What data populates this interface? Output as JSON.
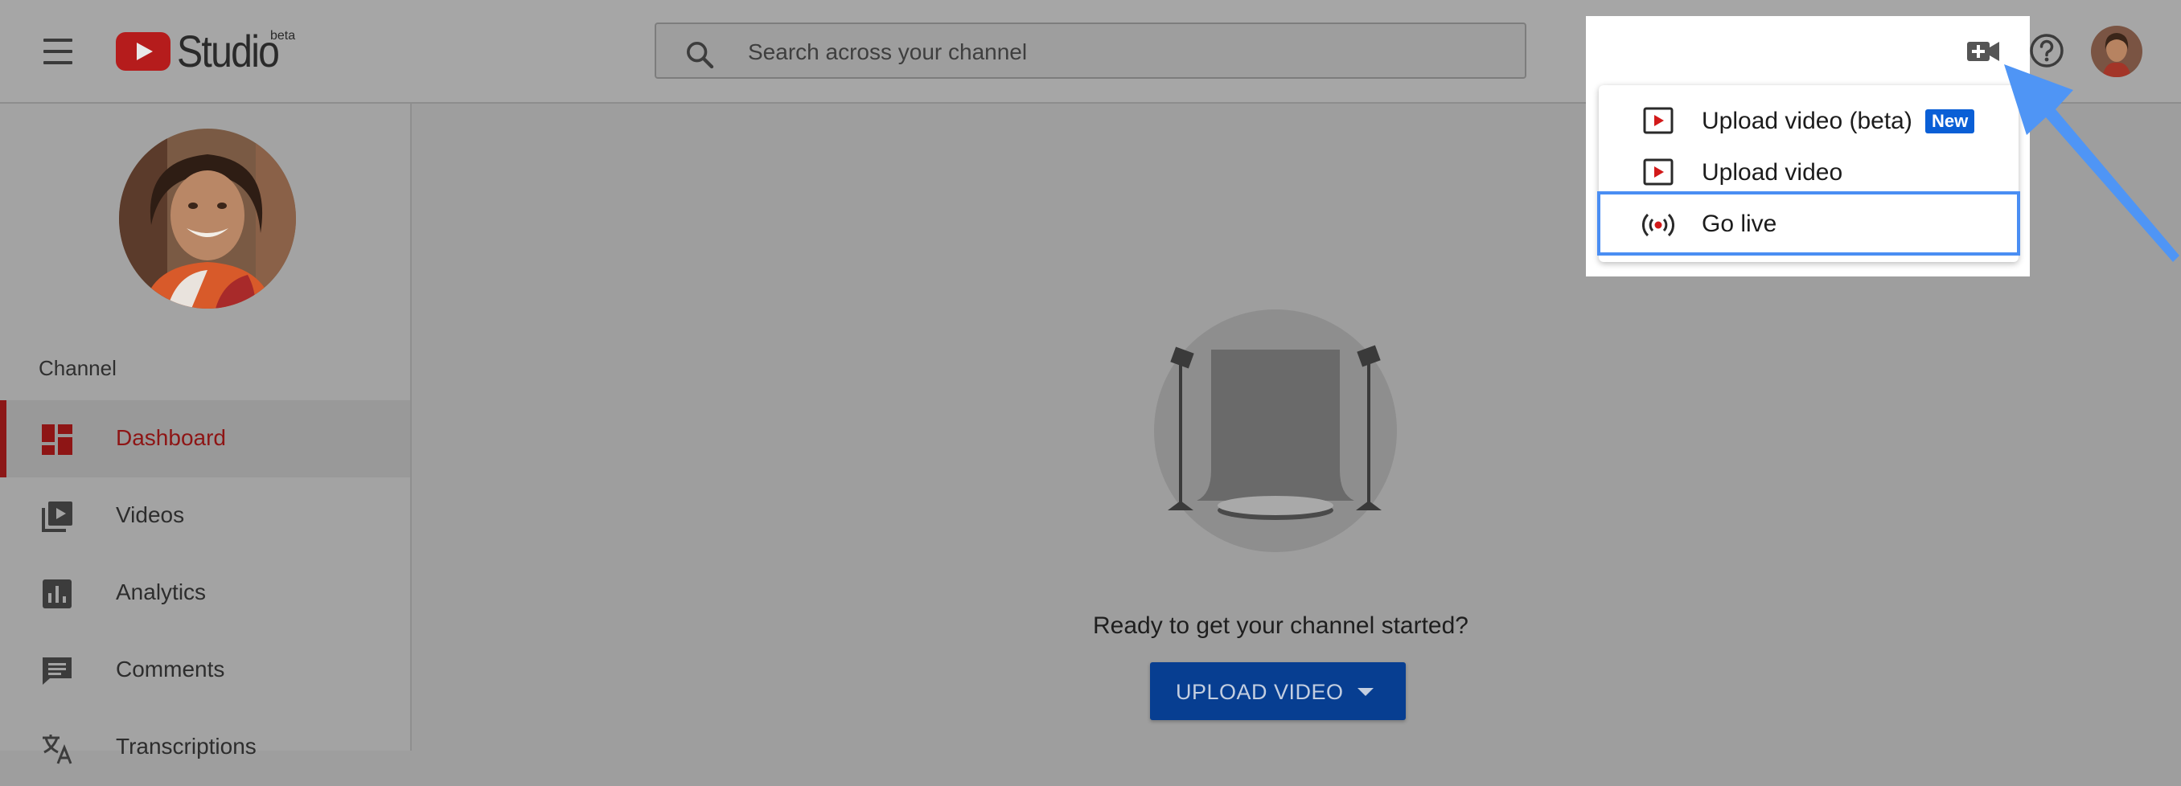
{
  "header": {
    "logo_text": "Studio",
    "logo_badge": "beta",
    "search": {
      "placeholder": "Search across your channel",
      "value": ""
    },
    "icons": {
      "menu": "hamburger-icon",
      "create": "video-camera-add-icon",
      "help": "help-circle-icon",
      "account": "avatar"
    }
  },
  "create_menu": {
    "items": [
      {
        "label": "Upload video (beta)",
        "badge": "New",
        "icon": "upload-video-icon"
      },
      {
        "label": "Upload video",
        "icon": "upload-video-icon"
      },
      {
        "label": "Go live",
        "icon": "live-broadcast-icon",
        "focused": true
      }
    ]
  },
  "sidebar": {
    "section_label": "Channel",
    "items": [
      {
        "label": "Dashboard",
        "icon": "dashboard-icon",
        "active": true
      },
      {
        "label": "Videos",
        "icon": "videos-icon"
      },
      {
        "label": "Analytics",
        "icon": "analytics-icon"
      },
      {
        "label": "Comments",
        "icon": "comments-icon"
      },
      {
        "label": "Transcriptions",
        "icon": "transcriptions-icon"
      }
    ]
  },
  "main": {
    "prompt_text": "Ready to get your channel started?",
    "upload_button_label": "UPLOAD VIDEO"
  },
  "colors": {
    "accent_red": "#8e1515",
    "primary_blue": "#073e91",
    "badge_blue": "#0a5fd6",
    "focus_outline": "#4a8ef3",
    "annotation_arrow": "#4f95f5"
  }
}
